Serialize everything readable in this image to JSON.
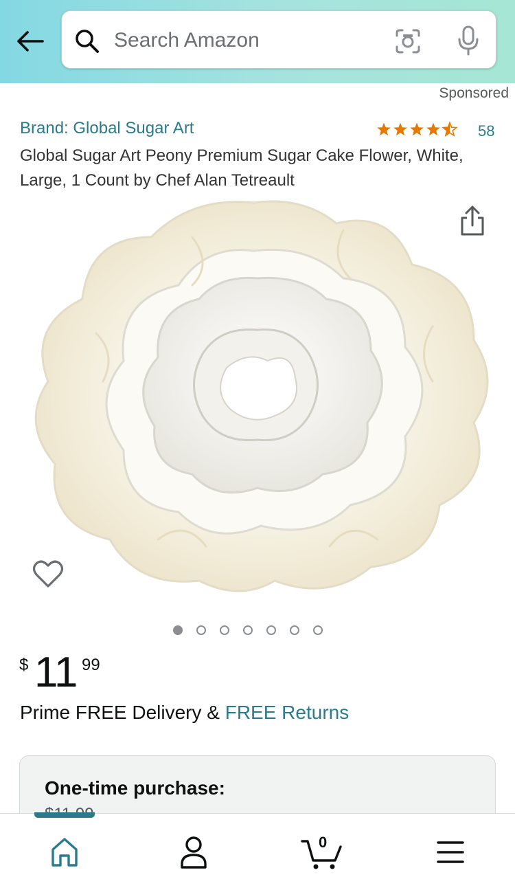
{
  "header": {
    "back_label": "Back",
    "search": {
      "placeholder": "Search Amazon"
    }
  },
  "product": {
    "sponsored": "Sponsored",
    "brand": "Brand: Global Sugar Art",
    "rating": 4.5,
    "review_count": "58",
    "title": "Global Sugar Art Peony Premium Sugar Cake Flower, White, Large, 1 Count by Chef Alan Tetreault",
    "image_count": 7,
    "active_image": 1,
    "price": {
      "symbol": "$",
      "whole": "11",
      "fraction": "99"
    },
    "delivery_prefix": "Prime FREE Delivery & ",
    "delivery_link": "FREE Returns"
  },
  "purchase": {
    "label": "One-time purchase:",
    "price": "$11.99"
  },
  "nav": {
    "cart_count": "0",
    "items": [
      "home-icon",
      "account-icon",
      "cart-icon",
      "menu-icon"
    ]
  },
  "colors": {
    "accent": "#2b7b8c",
    "star": "#e67a00",
    "header_start": "#84d8e3",
    "header_end": "#a5e6d4"
  }
}
